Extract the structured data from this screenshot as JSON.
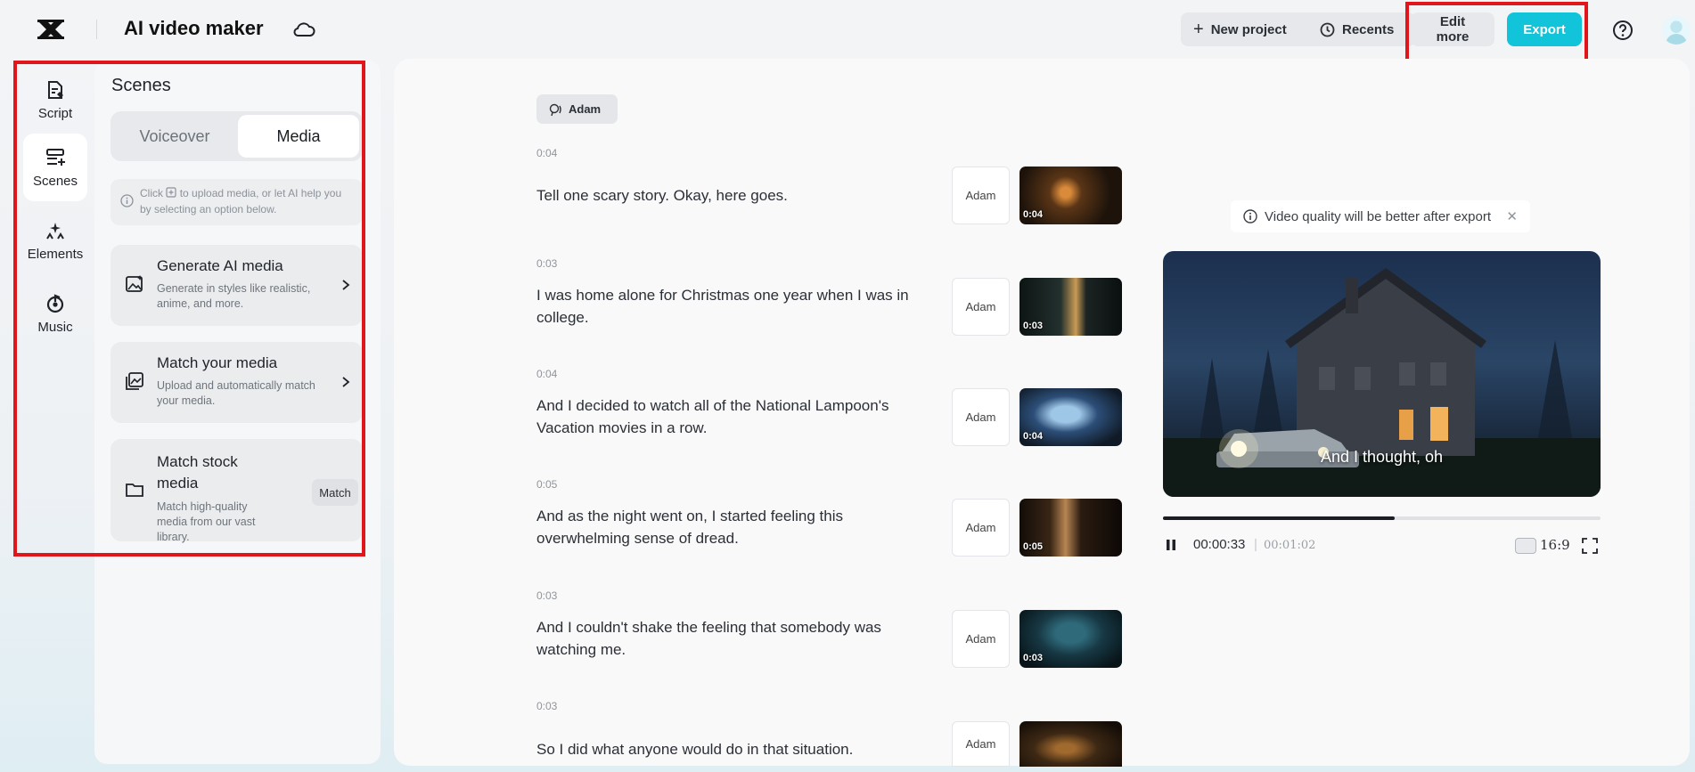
{
  "header": {
    "app_title": "AI video maker",
    "new_project": "New project",
    "recents": "Recents",
    "edit_more": "Edit more",
    "export": "Export"
  },
  "rail": {
    "items": [
      {
        "label": "Script",
        "icon": "script-icon"
      },
      {
        "label": "Scenes",
        "icon": "scenes-icon",
        "active": true
      },
      {
        "label": "Elements",
        "icon": "elements-icon"
      },
      {
        "label": "Music",
        "icon": "music-icon"
      }
    ]
  },
  "panel": {
    "title": "Scenes",
    "tabs": [
      "Voiceover",
      "Media"
    ],
    "active_tab": "Media",
    "hint_prefix": "Click",
    "hint_rest": "to upload media, or let AI help you by selecting an option below.",
    "cards": [
      {
        "title": "Generate AI media",
        "desc": "Generate in styles like realistic, anime, and more."
      },
      {
        "title": "Match your media",
        "desc": "Upload and automatically match your media."
      },
      {
        "title": "Match stock media",
        "desc": "Match high-quality media from our vast library.",
        "action": "Match"
      }
    ]
  },
  "script": {
    "speaker": "Adam",
    "scenes": [
      {
        "time": "0:04",
        "text": "Tell one scary story. Okay, here goes.",
        "voice": "Adam",
        "duration": "0:04"
      },
      {
        "time": "0:03",
        "text": "I was home alone for Christmas one year when I was in college.",
        "voice": "Adam",
        "duration": "0:03"
      },
      {
        "time": "0:04",
        "text": "And I decided to watch all of the National Lampoon's Vacation movies in a row.",
        "voice": "Adam",
        "duration": "0:04"
      },
      {
        "time": "0:05",
        "text": "And as the night went on, I started feeling this overwhelming sense of dread.",
        "voice": "Adam",
        "duration": "0:05"
      },
      {
        "time": "0:03",
        "text": "And I couldn't shake the feeling that somebody was watching me.",
        "voice": "Adam",
        "duration": "0:03"
      },
      {
        "time": "0:03",
        "text": "So I did what anyone would do in that situation.",
        "voice": "Adam",
        "duration": ""
      }
    ]
  },
  "preview": {
    "quality_note": "Video quality will be better after export",
    "subtitle": "And I thought, oh",
    "current_time": "00:00:33",
    "separator": "|",
    "total_time": "00:01:02",
    "aspect_ratio": "16:9",
    "progress": 0.53
  },
  "colors": {
    "accent": "#12c4d9",
    "highlight_box": "#e0161b"
  }
}
